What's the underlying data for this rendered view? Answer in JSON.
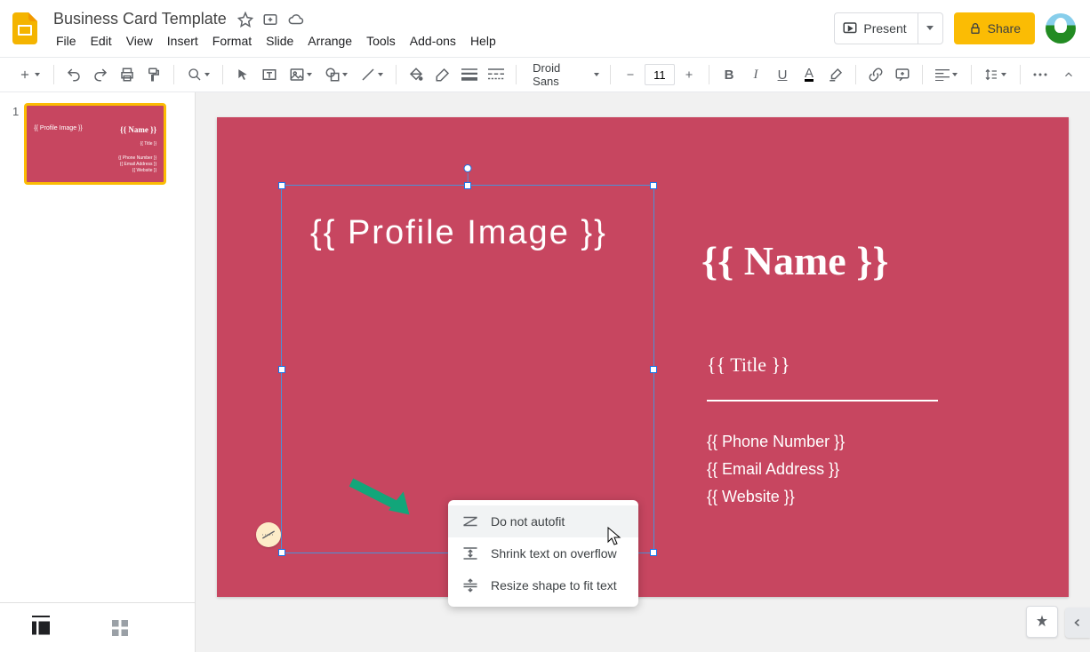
{
  "header": {
    "doc_title": "Business Card Template",
    "menu": [
      "File",
      "Edit",
      "View",
      "Insert",
      "Format",
      "Slide",
      "Arrange",
      "Tools",
      "Add-ons",
      "Help"
    ],
    "present_label": "Present",
    "share_label": "Share"
  },
  "toolbar": {
    "font": "Droid Sans",
    "font_size": "11"
  },
  "sidebar": {
    "slide_number": "1"
  },
  "slide": {
    "bg_color": "#c74660",
    "profile_image": "{{ Profile Image }}",
    "name": "{{ Name }}",
    "title": "{{ Title }}",
    "phone": "{{ Phone Number }}",
    "email": "{{ Email Address }}",
    "website": "{{ Website }}"
  },
  "context_menu": {
    "items": [
      "Do not autofit",
      "Shrink text on overflow",
      "Resize shape to fit text"
    ]
  }
}
